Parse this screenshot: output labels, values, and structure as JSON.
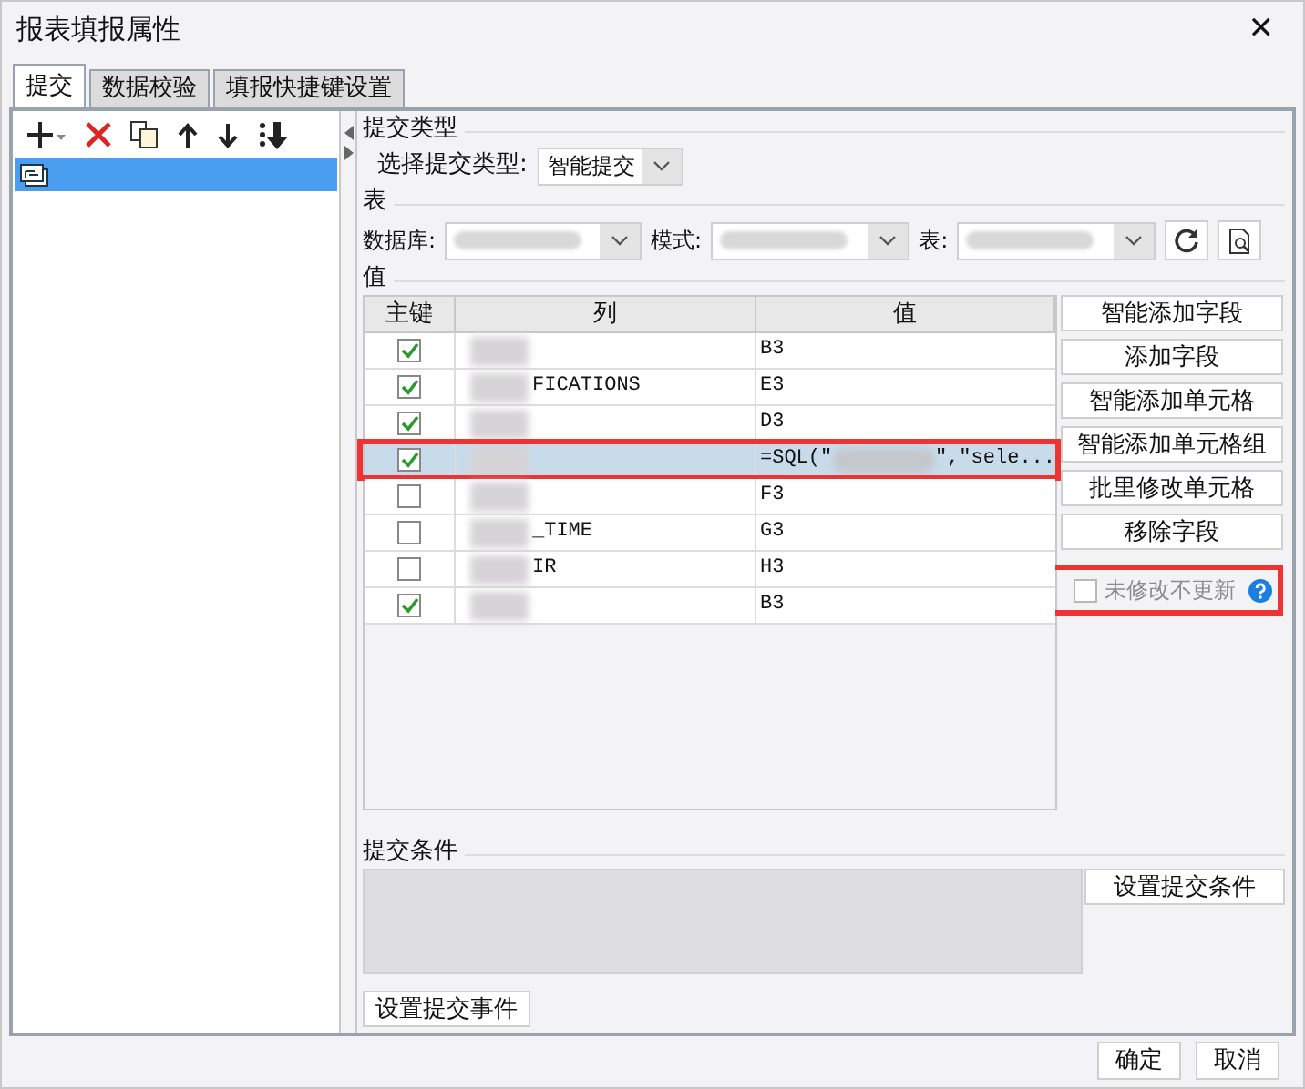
{
  "window": {
    "title": "报表填报属性",
    "close": "✕"
  },
  "tabs": [
    {
      "label": "提交",
      "selected": true
    },
    {
      "label": "数据校验",
      "selected": false
    },
    {
      "label": "填报快捷键设置",
      "selected": false
    }
  ],
  "sidebar": {
    "items": [
      {
        "selected": true
      }
    ]
  },
  "submit_type": {
    "legend": "提交类型",
    "label": "选择提交类型:",
    "value": "智能提交"
  },
  "table_section": {
    "legend": "表",
    "database_label": "数据库:",
    "schema_label": "模式:",
    "table_label": "表:"
  },
  "values": {
    "legend": "值",
    "columns": [
      "主键",
      "列",
      "值"
    ],
    "rows": [
      {
        "key": true,
        "column": "",
        "value": "B3",
        "highlighted": false
      },
      {
        "key": true,
        "column": "FICATIONS",
        "value": "E3",
        "highlighted": false
      },
      {
        "key": true,
        "column": "",
        "value": "D3",
        "highlighted": false
      },
      {
        "key": true,
        "column": "",
        "value": "=SQL(\"",
        "value_end": "\",\"sele...",
        "highlighted": true,
        "selected": true
      },
      {
        "key": false,
        "column": "",
        "value": "F3",
        "highlighted": false
      },
      {
        "key": false,
        "column": "_TIME",
        "value": "G3",
        "highlighted": false
      },
      {
        "key": false,
        "column": "IR",
        "value": "H3",
        "highlighted": false
      },
      {
        "key": true,
        "column": "",
        "value": "B3",
        "highlighted": false
      }
    ],
    "buttons": [
      "智能添加字段",
      "添加字段",
      "智能添加单元格",
      "智能添加单元格组",
      "批里修改单元格",
      "移除字段"
    ],
    "no_update": {
      "label": "未修改不更新",
      "checked": false,
      "disabled": true,
      "highlighted": true
    }
  },
  "condition": {
    "legend": "提交条件",
    "button": "设置提交条件"
  },
  "event_button": "设置提交事件",
  "footer": {
    "buttons": [
      "确定",
      "取消"
    ]
  }
}
